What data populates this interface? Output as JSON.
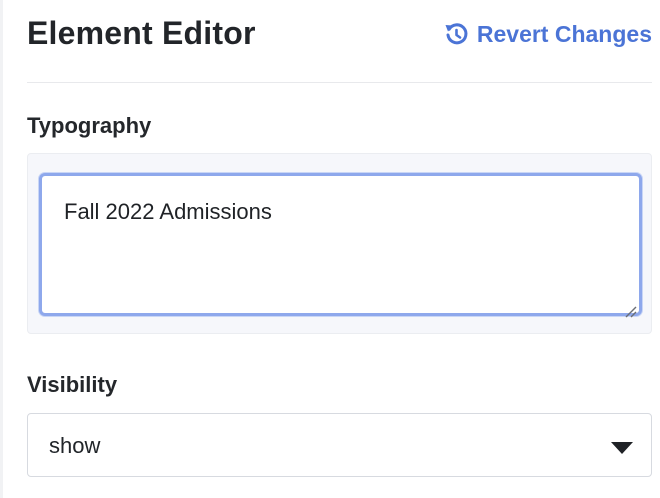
{
  "header": {
    "title": "Element Editor",
    "revert_label": "Revert Changes",
    "revert_icon": "history-icon",
    "accent_color": "#4b74d6"
  },
  "typography": {
    "label": "Typography",
    "value": "Fall 2022 Admissions"
  },
  "visibility": {
    "label": "Visibility",
    "selected": "show",
    "caret_icon": "caret-down-icon"
  }
}
